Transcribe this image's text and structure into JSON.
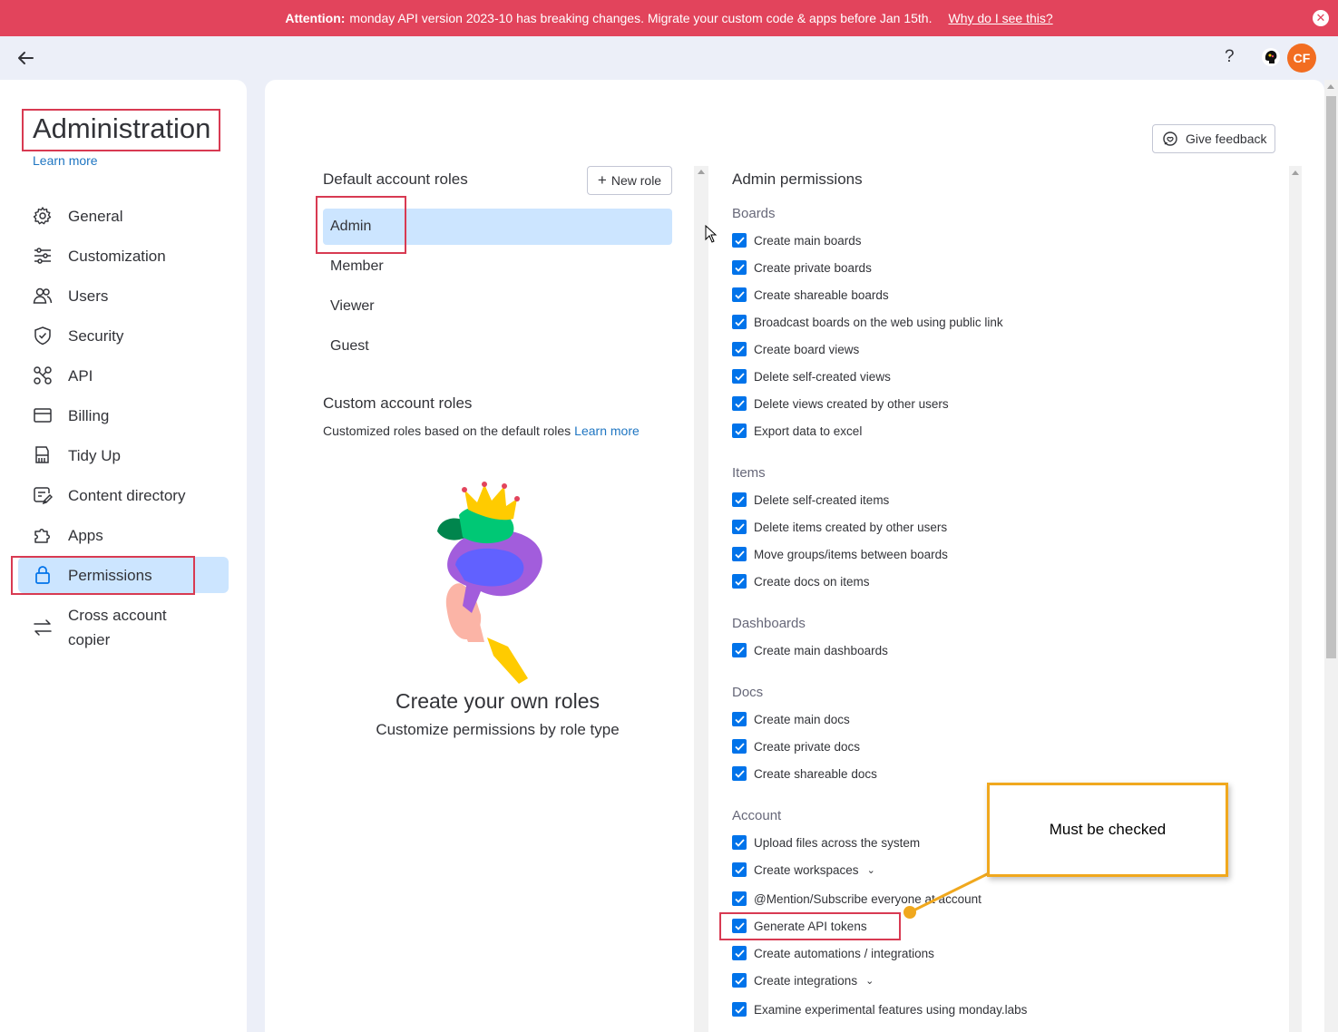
{
  "banner": {
    "bold": "Attention:",
    "text": "monday API version 2023-10 has breaking changes. Migrate your custom code & apps before Jan 15th.",
    "link": "Why do I see this?",
    "close_icon": "close-icon"
  },
  "topbar": {
    "help": "?",
    "avatar_initials": "CF",
    "avatar_color": "#f26d21"
  },
  "sidebar": {
    "title": "Administration",
    "learn_more": "Learn more",
    "items": [
      {
        "label": "General",
        "icon": "gear-icon"
      },
      {
        "label": "Customization",
        "icon": "sliders-icon"
      },
      {
        "label": "Users",
        "icon": "users-icon"
      },
      {
        "label": "Security",
        "icon": "shield-icon"
      },
      {
        "label": "API",
        "icon": "api-icon"
      },
      {
        "label": "Billing",
        "icon": "credit-card-icon"
      },
      {
        "label": "Tidy Up",
        "icon": "broom-icon"
      },
      {
        "label": "Content directory",
        "icon": "content-directory-icon"
      },
      {
        "label": "Apps",
        "icon": "puzzle-icon"
      },
      {
        "label": "Permissions",
        "icon": "lock-icon",
        "active": true
      },
      {
        "label": "Cross account copier",
        "icon": "arrows-swap-icon"
      }
    ]
  },
  "main": {
    "feedback_label": "Give feedback",
    "default_roles_title": "Default account roles",
    "new_role_label": "New role",
    "roles": [
      "Admin",
      "Member",
      "Viewer",
      "Guest"
    ],
    "active_role": "Admin",
    "custom_roles_title": "Custom account roles",
    "custom_roles_desc": "Customized roles based on the default roles",
    "custom_roles_learn_more": "Learn more",
    "create_title": "Create your own roles",
    "create_subtitle": "Customize permissions by role type"
  },
  "permissions": {
    "title": "Admin permissions",
    "sections": [
      {
        "name": "Boards",
        "items": [
          "Create main boards",
          "Create private boards",
          "Create shareable boards",
          "Broadcast boards on the web using public link",
          "Create board views",
          "Delete self-created views",
          "Delete views created by other users",
          "Export data to excel"
        ]
      },
      {
        "name": "Items",
        "items": [
          "Delete self-created items",
          "Delete items created by other users",
          "Move groups/items between boards",
          "Create docs on items"
        ]
      },
      {
        "name": "Dashboards",
        "items": [
          "Create main dashboards"
        ]
      },
      {
        "name": "Docs",
        "items": [
          "Create main docs",
          "Create private docs",
          "Create shareable docs"
        ]
      },
      {
        "name": "Account",
        "items": [
          "Upload files across the system",
          "Create workspaces",
          "@Mention/Subscribe everyone at account",
          "Generate API tokens",
          "Create automations / integrations",
          "Create integrations",
          "Examine experimental features using monday.labs"
        ]
      }
    ],
    "expandable": [
      "Create workspaces",
      "Create integrations"
    ],
    "checked_color": "#0073ea"
  },
  "annotation": {
    "text": "Must be checked",
    "color": "#f0a81e"
  }
}
